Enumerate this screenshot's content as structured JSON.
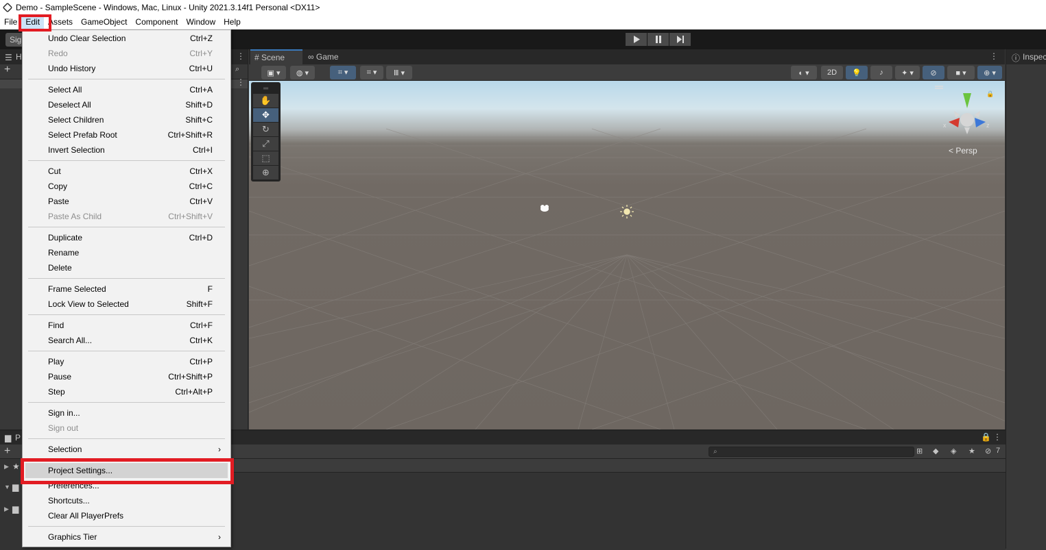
{
  "window": {
    "title": "Demo - SampleScene - Windows, Mac, Linux - Unity 2021.3.14f1 Personal <DX11>"
  },
  "menubar": {
    "items": [
      "File",
      "Edit",
      "Assets",
      "GameObject",
      "Component",
      "Window",
      "Help"
    ]
  },
  "toolbar": {
    "sign_label": "Sign"
  },
  "hierarchy": {
    "tab_label": "H"
  },
  "scene_tabs": {
    "scene": "Scene",
    "game": "Game"
  },
  "scene_toolbar": {
    "mode_2d": "2D"
  },
  "viewport": {
    "persp_label": "< Persp",
    "gizmo_x": "x",
    "gizmo_z": "z"
  },
  "inspector": {
    "tab_label": "Inspec"
  },
  "project_panel": {
    "tab_label": "P",
    "hidden_count": "7",
    "search_placeholder": ""
  },
  "edit_menu": {
    "groups": [
      [
        {
          "label": "Undo Clear Selection",
          "shortcut": "Ctrl+Z",
          "disabled": false
        },
        {
          "label": "Redo",
          "shortcut": "Ctrl+Y",
          "disabled": true
        },
        {
          "label": "Undo History",
          "shortcut": "Ctrl+U",
          "disabled": false
        }
      ],
      [
        {
          "label": "Select All",
          "shortcut": "Ctrl+A",
          "disabled": false
        },
        {
          "label": "Deselect All",
          "shortcut": "Shift+D",
          "disabled": false
        },
        {
          "label": "Select Children",
          "shortcut": "Shift+C",
          "disabled": false
        },
        {
          "label": "Select Prefab Root",
          "shortcut": "Ctrl+Shift+R",
          "disabled": false
        },
        {
          "label": "Invert Selection",
          "shortcut": "Ctrl+I",
          "disabled": false
        }
      ],
      [
        {
          "label": "Cut",
          "shortcut": "Ctrl+X",
          "disabled": false
        },
        {
          "label": "Copy",
          "shortcut": "Ctrl+C",
          "disabled": false
        },
        {
          "label": "Paste",
          "shortcut": "Ctrl+V",
          "disabled": false
        },
        {
          "label": "Paste As Child",
          "shortcut": "Ctrl+Shift+V",
          "disabled": true
        }
      ],
      [
        {
          "label": "Duplicate",
          "shortcut": "Ctrl+D",
          "disabled": false
        },
        {
          "label": "Rename",
          "shortcut": "",
          "disabled": false
        },
        {
          "label": "Delete",
          "shortcut": "",
          "disabled": false
        }
      ],
      [
        {
          "label": "Frame Selected",
          "shortcut": "F",
          "disabled": false
        },
        {
          "label": "Lock View to Selected",
          "shortcut": "Shift+F",
          "disabled": false
        }
      ],
      [
        {
          "label": "Find",
          "shortcut": "Ctrl+F",
          "disabled": false
        },
        {
          "label": "Search All...",
          "shortcut": "Ctrl+K",
          "disabled": false
        }
      ],
      [
        {
          "label": "Play",
          "shortcut": "Ctrl+P",
          "disabled": false
        },
        {
          "label": "Pause",
          "shortcut": "Ctrl+Shift+P",
          "disabled": false
        },
        {
          "label": "Step",
          "shortcut": "Ctrl+Alt+P",
          "disabled": false
        }
      ],
      [
        {
          "label": "Sign in...",
          "shortcut": "",
          "disabled": false
        },
        {
          "label": "Sign out",
          "shortcut": "",
          "disabled": true
        }
      ],
      [
        {
          "label": "Selection",
          "shortcut": "",
          "disabled": false,
          "submenu": true
        }
      ],
      [
        {
          "label": "Project Settings...",
          "shortcut": "",
          "disabled": false,
          "hover": true
        },
        {
          "label": "Preferences...",
          "shortcut": "",
          "disabled": false
        },
        {
          "label": "Shortcuts...",
          "shortcut": "",
          "disabled": false
        },
        {
          "label": "Clear All PlayerPrefs",
          "shortcut": "",
          "disabled": false
        }
      ],
      [
        {
          "label": "Graphics Tier",
          "shortcut": "",
          "disabled": false,
          "submenu": true
        }
      ]
    ]
  },
  "colors": {
    "highlight": "#e21c23",
    "accent_blue": "#3a79bb",
    "menu_bg": "#f2f2f2"
  }
}
